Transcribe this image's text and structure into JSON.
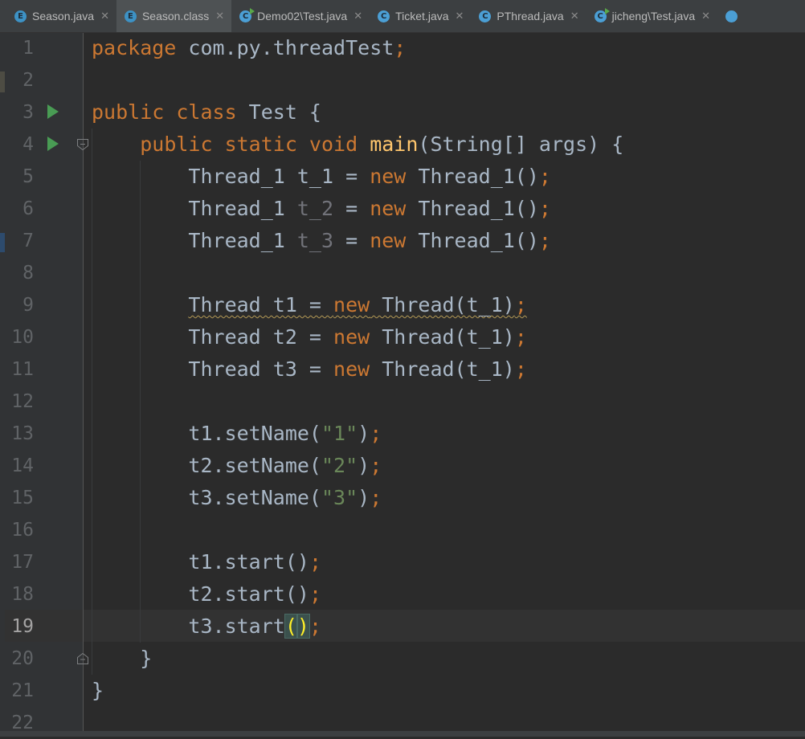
{
  "tabs": [
    {
      "label": "Season.java",
      "icon": "enum-file-icon",
      "icon_letter": "E",
      "active": false,
      "runnable": false
    },
    {
      "label": "Season.class",
      "icon": "enum-file-icon",
      "icon_letter": "E",
      "active": true,
      "runnable": false
    },
    {
      "label": "Demo02\\Test.java",
      "icon": "runnable-class-icon",
      "icon_letter": "C",
      "active": false,
      "runnable": true
    },
    {
      "label": "Ticket.java",
      "icon": "class-file-icon",
      "icon_letter": "C",
      "active": false,
      "runnable": false
    },
    {
      "label": "PThread.java",
      "icon": "class-file-icon",
      "icon_letter": "C",
      "active": false,
      "runnable": false
    },
    {
      "label": "jicheng\\Test.java",
      "icon": "runnable-class-icon",
      "icon_letter": "C",
      "active": false,
      "runnable": true
    },
    {
      "label": "",
      "icon": "class-file-icon",
      "icon_letter": "",
      "active": false,
      "runnable": false
    }
  ],
  "close_glyph": "✕",
  "editor": {
    "current_line": 19,
    "lines": [
      {
        "n": "1",
        "tokens": [
          [
            "kw",
            "package"
          ],
          [
            "",
            "com.py.threadTest"
          ],
          [
            "semi",
            ";"
          ]
        ]
      },
      {
        "n": "2",
        "tokens": []
      },
      {
        "n": "3",
        "run": true,
        "tokens": [
          [
            "kw",
            "public class"
          ],
          [
            "",
            "Test {"
          ]
        ],
        "spaced": true
      },
      {
        "n": "4",
        "run": true,
        "fold": "open",
        "tokens": [
          [
            "",
            "    "
          ],
          [
            "kw",
            "public static void"
          ],
          [
            "",
            ""
          ],
          [
            "fn",
            "main"
          ],
          [
            "",
            "(String[] args) {"
          ]
        ],
        "spaced": true
      },
      {
        "n": "5",
        "tokens": [
          [
            "",
            "        Thread_1 t_1 = "
          ],
          [
            "kw",
            "new"
          ],
          [
            "",
            " Thread_1()"
          ],
          [
            "semi",
            ";"
          ]
        ]
      },
      {
        "n": "6",
        "tokens": [
          [
            "",
            "        Thread_1 "
          ],
          [
            "dim",
            "t_2"
          ],
          [
            "",
            " = "
          ],
          [
            "kw",
            "new"
          ],
          [
            "",
            " Thread_1()"
          ],
          [
            "semi",
            ";"
          ]
        ]
      },
      {
        "n": "7",
        "tokens": [
          [
            "",
            "        Thread_1 "
          ],
          [
            "dim",
            "t_3"
          ],
          [
            "",
            " = "
          ],
          [
            "kw",
            "new"
          ],
          [
            "",
            " Thread_1()"
          ],
          [
            "semi",
            ";"
          ]
        ]
      },
      {
        "n": "8",
        "tokens": []
      },
      {
        "n": "9",
        "warn": true,
        "tokens": [
          [
            "",
            "        Thread t1 = "
          ],
          [
            "kw",
            "new"
          ],
          [
            "",
            " Thread(t_1)"
          ],
          [
            "semi",
            ";"
          ]
        ]
      },
      {
        "n": "10",
        "tokens": [
          [
            "",
            "        Thread t2 = "
          ],
          [
            "kw",
            "new"
          ],
          [
            "",
            " Thread(t_1)"
          ],
          [
            "semi",
            ";"
          ]
        ]
      },
      {
        "n": "11",
        "tokens": [
          [
            "",
            "        Thread t3 = "
          ],
          [
            "kw",
            "new"
          ],
          [
            "",
            " Thread(t_1)"
          ],
          [
            "semi",
            ";"
          ]
        ]
      },
      {
        "n": "12",
        "tokens": []
      },
      {
        "n": "13",
        "tokens": [
          [
            "",
            "        t1.setName("
          ],
          [
            "str",
            "\"1\""
          ],
          [
            "",
            ")"
          ],
          [
            "semi",
            ";"
          ]
        ]
      },
      {
        "n": "14",
        "tokens": [
          [
            "",
            "        t2.setName("
          ],
          [
            "str",
            "\"2\""
          ],
          [
            "",
            ")"
          ],
          [
            "semi",
            ";"
          ]
        ]
      },
      {
        "n": "15",
        "tokens": [
          [
            "",
            "        t3.setName("
          ],
          [
            "str",
            "\"3\""
          ],
          [
            "",
            ")"
          ],
          [
            "semi",
            ";"
          ]
        ]
      },
      {
        "n": "16",
        "tokens": []
      },
      {
        "n": "17",
        "tokens": [
          [
            "",
            "        t1.start()"
          ],
          [
            "semi",
            ";"
          ]
        ]
      },
      {
        "n": "18",
        "tokens": [
          [
            "",
            "        t2.start()"
          ],
          [
            "semi",
            ";"
          ]
        ]
      },
      {
        "n": "19",
        "caret": true,
        "tokens": [
          [
            "",
            "        t3.start"
          ],
          [
            "brace-match",
            "("
          ],
          [
            "caret",
            ""
          ],
          [
            "brace-match",
            ")"
          ],
          [
            "semi",
            ";"
          ]
        ]
      },
      {
        "n": "20",
        "fold": "close",
        "tokens": [
          [
            "",
            "    }"
          ]
        ]
      },
      {
        "n": "21",
        "tokens": [
          [
            "",
            "}"
          ]
        ]
      },
      {
        "n": "22",
        "tokens": []
      }
    ]
  },
  "colors": {
    "background": "#2b2b2b",
    "gutter": "#313335",
    "keyword": "#cc7832",
    "function": "#ffc66d",
    "string": "#6a8759",
    "text": "#a9b7c6",
    "run_icon": "#499c54"
  }
}
